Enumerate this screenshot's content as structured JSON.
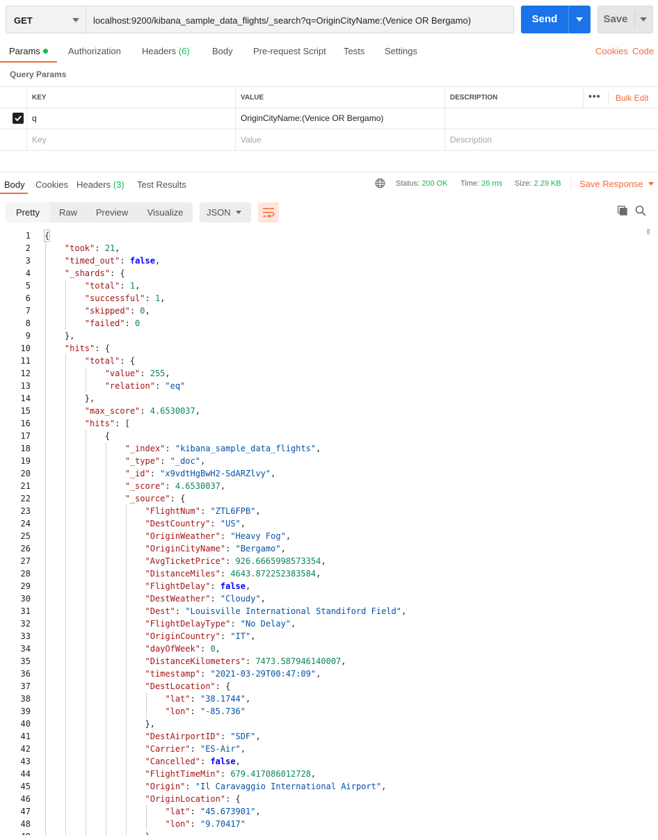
{
  "request": {
    "method": "GET",
    "url": "localhost:9200/kibana_sample_data_flights/_search?q=OriginCityName:(Venice OR Bergamo)",
    "send_label": "Send",
    "save_label": "Save"
  },
  "request_tabs": {
    "params": "Params",
    "authorization": "Authorization",
    "headers": "Headers",
    "headers_count": "(6)",
    "body": "Body",
    "prerequest": "Pre-request Script",
    "tests": "Tests",
    "settings": "Settings",
    "cookies": "Cookies",
    "code": "Code"
  },
  "query_params": {
    "title": "Query Params",
    "headers": {
      "key": "KEY",
      "value": "VALUE",
      "description": "DESCRIPTION"
    },
    "more": "•••",
    "bulk_edit": "Bulk Edit",
    "rows": [
      {
        "checked": true,
        "key": "q",
        "value": "OriginCityName:(Venice OR Bergamo)",
        "description": ""
      }
    ],
    "placeholders": {
      "key": "Key",
      "value": "Value",
      "description": "Description"
    }
  },
  "response_tabs": {
    "body": "Body",
    "cookies": "Cookies",
    "headers": "Headers",
    "headers_count": "(3)",
    "test_results": "Test Results"
  },
  "response_meta": {
    "status_label": "Status:",
    "status": "200 OK",
    "time_label": "Time:",
    "time": "26 ms",
    "size_label": "Size:",
    "size": "2.29 KB",
    "save_response": "Save Response"
  },
  "format": {
    "views": [
      "Pretty",
      "Raw",
      "Preview",
      "Visualize"
    ],
    "active": "Pretty",
    "language": "JSON"
  },
  "colors": {
    "accent": "#f26b3a",
    "primary": "#1a73e8",
    "success": "#0cbb52"
  },
  "code_lines": [
    "{",
    "    \"took\": 21,",
    "    \"timed_out\": false,",
    "    \"_shards\": {",
    "        \"total\": 1,",
    "        \"successful\": 1,",
    "        \"skipped\": 0,",
    "        \"failed\": 0",
    "    },",
    "    \"hits\": {",
    "        \"total\": {",
    "            \"value\": 255,",
    "            \"relation\": \"eq\"",
    "        },",
    "        \"max_score\": 4.6530037,",
    "        \"hits\": [",
    "            {",
    "                \"_index\": \"kibana_sample_data_flights\",",
    "                \"_type\": \"_doc\",",
    "                \"_id\": \"x9vdtHgBwH2-SdARZlvy\",",
    "                \"_score\": 4.6530037,",
    "                \"_source\": {",
    "                    \"FlightNum\": \"ZTL6FPB\",",
    "                    \"DestCountry\": \"US\",",
    "                    \"OriginWeather\": \"Heavy Fog\",",
    "                    \"OriginCityName\": \"Bergamo\",",
    "                    \"AvgTicketPrice\": 926.6665998573354,",
    "                    \"DistanceMiles\": 4643.872252383584,",
    "                    \"FlightDelay\": false,",
    "                    \"DestWeather\": \"Cloudy\",",
    "                    \"Dest\": \"Louisville International Standiford Field\",",
    "                    \"FlightDelayType\": \"No Delay\",",
    "                    \"OriginCountry\": \"IT\",",
    "                    \"dayOfWeek\": 0,",
    "                    \"DistanceKilometers\": 7473.587946140007,",
    "                    \"timestamp\": \"2021-03-29T00:47:09\",",
    "                    \"DestLocation\": {",
    "                        \"lat\": \"38.1744\",",
    "                        \"lon\": \"-85.736\"",
    "                    },",
    "                    \"DestAirportID\": \"SDF\",",
    "                    \"Carrier\": \"ES-Air\",",
    "                    \"Cancelled\": false,",
    "                    \"FlightTimeMin\": 679.417086012728,",
    "                    \"Origin\": \"Il Caravaggio International Airport\",",
    "                    \"OriginLocation\": {",
    "                        \"lat\": \"45.673901\",",
    "                        \"lon\": \"9.70417\"",
    "                    },"
  ]
}
